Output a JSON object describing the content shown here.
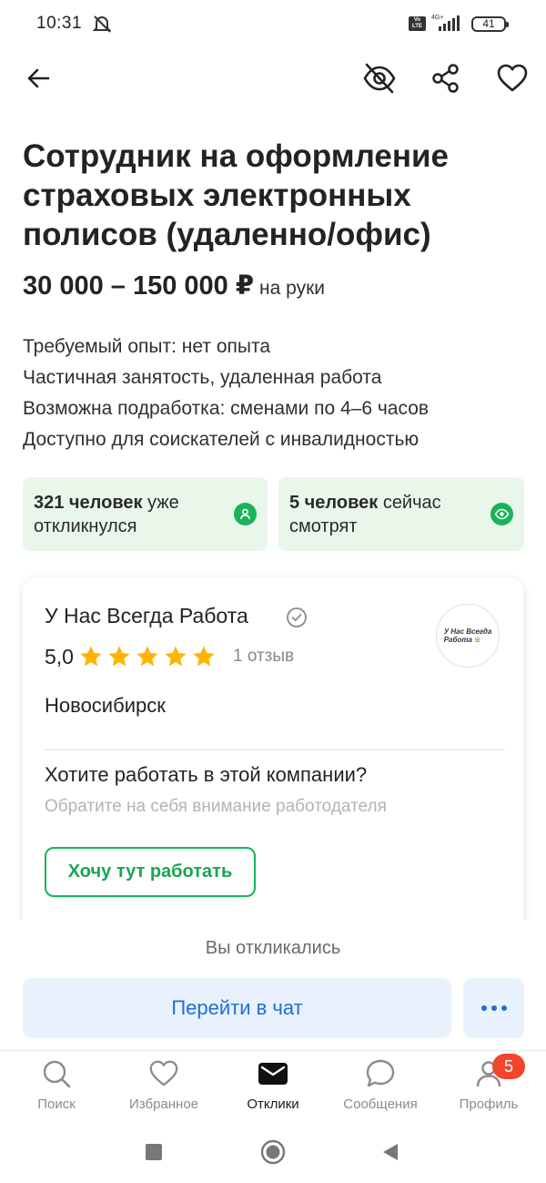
{
  "status_bar": {
    "time": "10:31",
    "volte": "Vo LTE",
    "network": "4G+",
    "battery": "41"
  },
  "vacancy": {
    "title": "Сотрудник на оформление страховых электронных полисов (удаленно/офис)",
    "salary": "30 000 – 150 000 ₽",
    "salary_note": "на руки",
    "details": [
      "Требуемый опыт: нет опыта",
      "Частичная занятость, удаленная работа",
      "Возможна подработка: сменами по 4–6 часов",
      "Доступно для соискателей с инвалидностью"
    ]
  },
  "stats": {
    "responded_count": "321 человек",
    "responded_text": "уже откликнулся",
    "watching_count": "5 человек",
    "watching_text": "сейчас смотрят"
  },
  "company": {
    "name": "У Нас Всегда Работа",
    "rating": "5,0",
    "stars": 5,
    "reviews": "1 отзыв",
    "city": "Новосибирск",
    "logo_line1": "У Нас Всегда",
    "logo_line2": "Работа",
    "question": "Хотите работать в этой компании?",
    "hint": "Обратите на себя внимание работодателя",
    "want_button": "Хочу тут работать"
  },
  "actions": {
    "responded_label": "Вы откликались",
    "chat_button": "Перейти в чат"
  },
  "nav": {
    "search": "Поиск",
    "favorites": "Избранное",
    "responses": "Отклики",
    "messages": "Сообщения",
    "profile": "Профиль",
    "profile_badge": "5"
  },
  "colors": {
    "accent_green": "#19b35c",
    "stat_bg": "#e9f6ea",
    "chat_bg": "#e8f1fc",
    "chat_text": "#1f6fd6",
    "star": "#ffb400",
    "badge": "#f1452c"
  }
}
